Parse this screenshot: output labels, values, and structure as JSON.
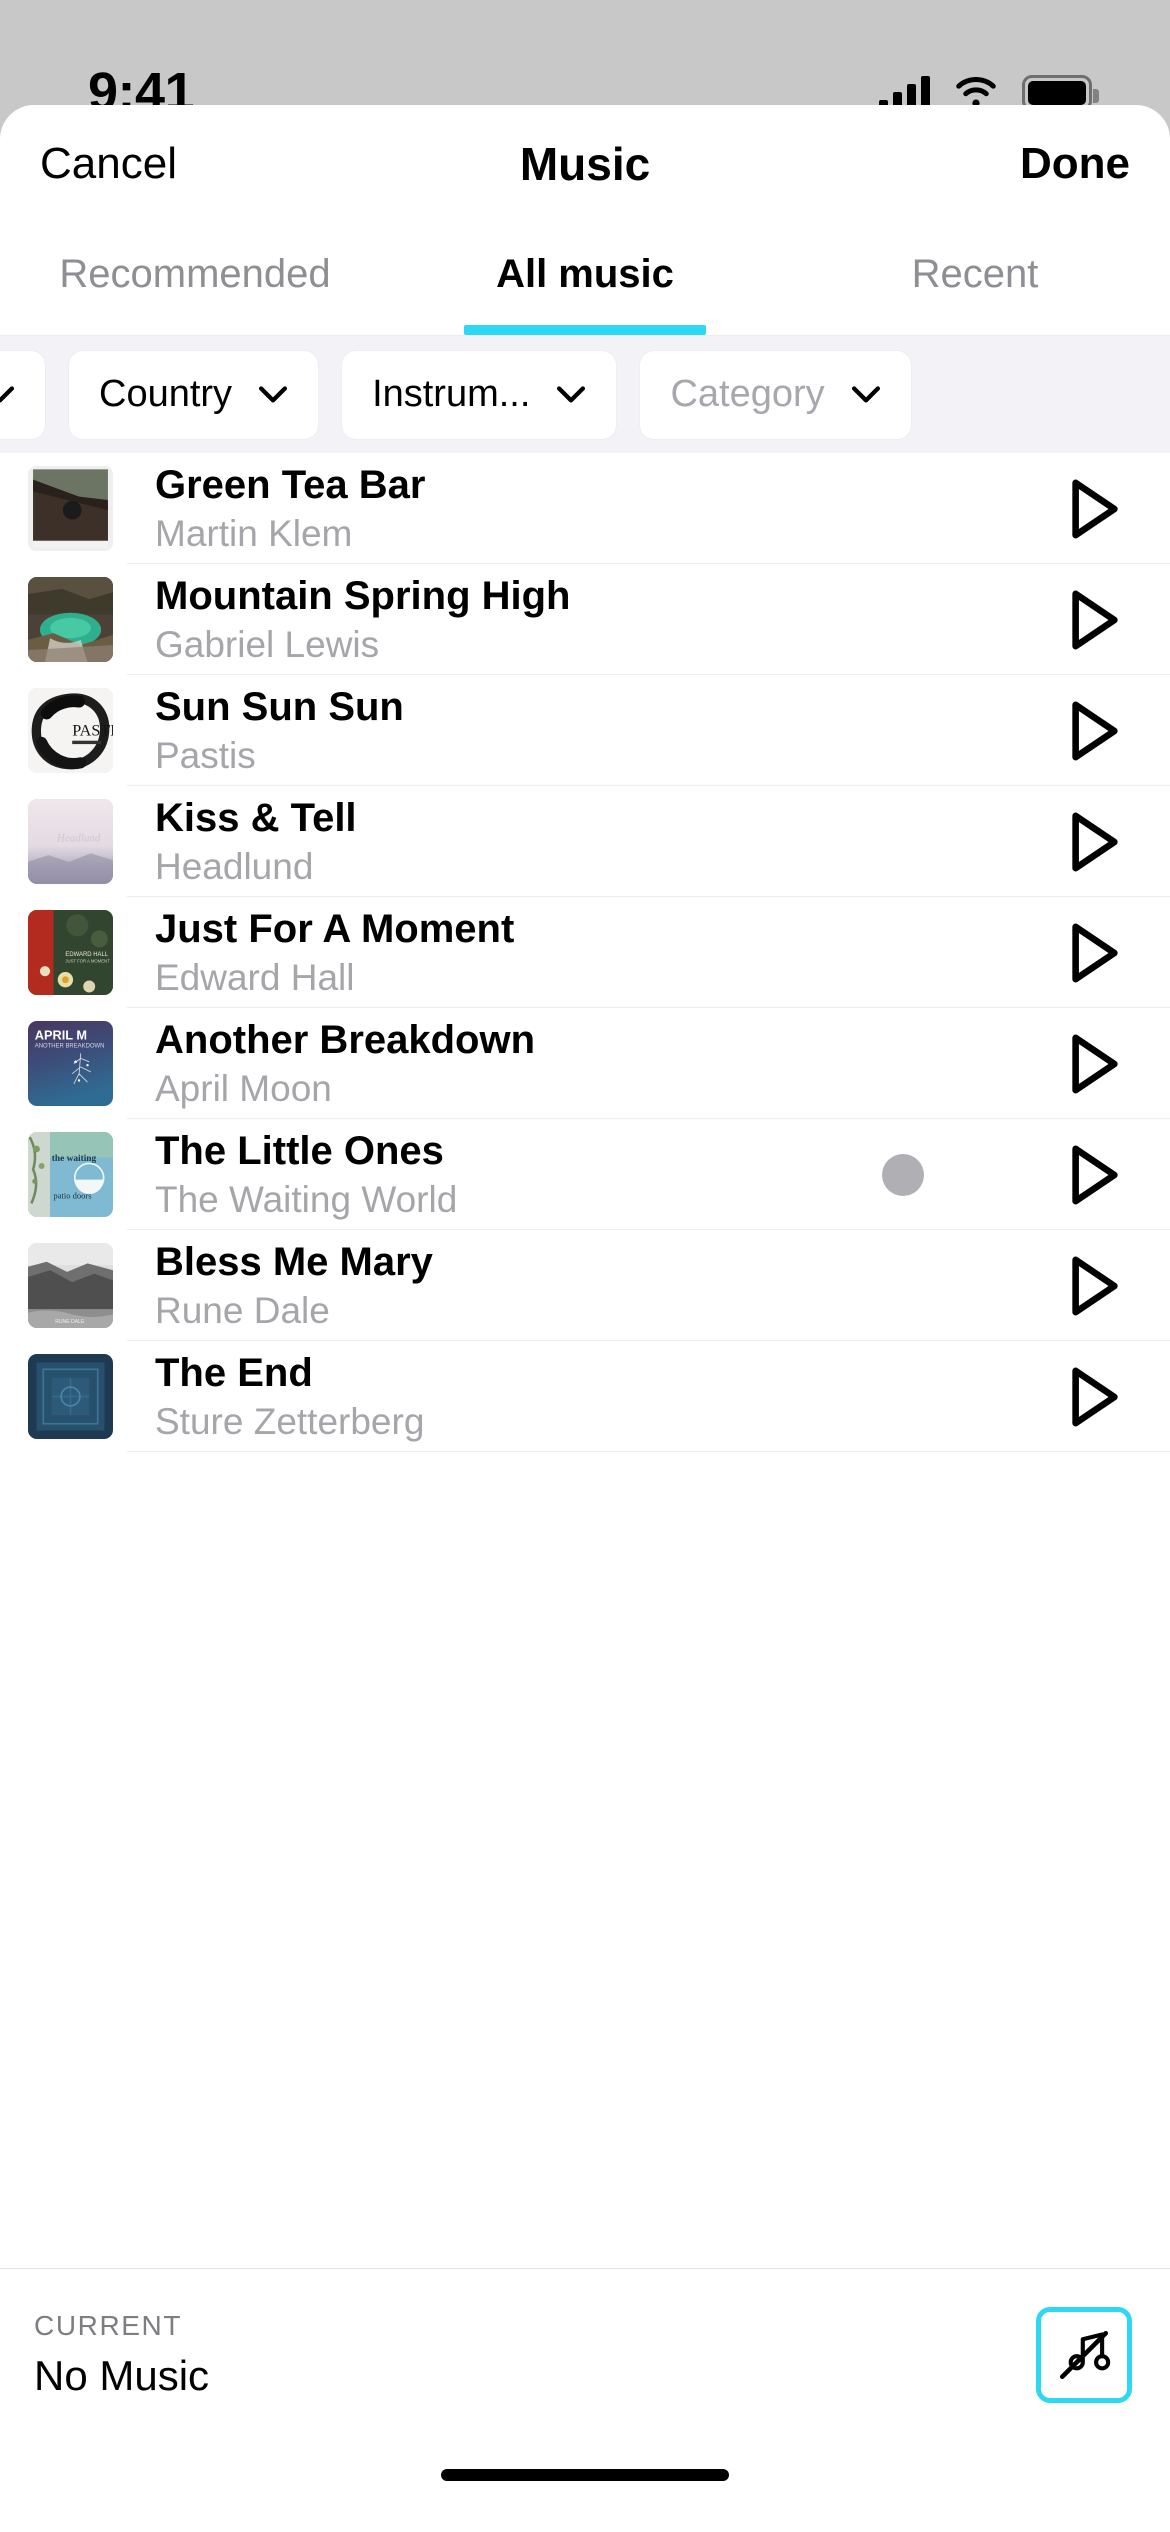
{
  "status_bar": {
    "time": "9:41",
    "icons": [
      "cellular-signal-icon",
      "wifi-icon",
      "battery-icon"
    ]
  },
  "header": {
    "cancel_label": "Cancel",
    "title": "Music",
    "done_label": "Done"
  },
  "tabs": {
    "items": [
      {
        "label": "Recommended",
        "active": false
      },
      {
        "label": "All music",
        "active": true
      },
      {
        "label": "Recent",
        "active": false
      }
    ],
    "active_indicator_color": "#2ed8f2"
  },
  "filters": {
    "chips": [
      {
        "label": "",
        "placeholder": false,
        "partial": true
      },
      {
        "label": "Country",
        "placeholder": false,
        "partial": false
      },
      {
        "label": "Instrum...",
        "placeholder": false,
        "partial": false
      },
      {
        "label": "Category",
        "placeholder": true,
        "partial": false
      }
    ]
  },
  "songs": [
    {
      "title": "Green Tea Bar",
      "artist": "Martin Klem",
      "art": "forest-bridge",
      "selected": false
    },
    {
      "title": "Mountain Spring High",
      "artist": "Gabriel Lewis",
      "art": "waterfall",
      "selected": false
    },
    {
      "title": "Sun Sun Sun",
      "artist": "Pastis",
      "art": "pastis-ink",
      "selected": false
    },
    {
      "title": "Kiss & Tell",
      "artist": "Headlund",
      "art": "pink-haze",
      "selected": false
    },
    {
      "title": "Just For A Moment",
      "artist": "Edward Hall",
      "art": "red-flowers",
      "selected": false
    },
    {
      "title": "Another Breakdown",
      "artist": "April Moon",
      "art": "april-moon",
      "selected": false
    },
    {
      "title": "The Little Ones",
      "artist": "The Waiting World",
      "art": "waiting-world",
      "selected": true
    },
    {
      "title": "Bless Me Mary",
      "artist": "Rune Dale",
      "art": "gray-cliffs",
      "selected": false
    },
    {
      "title": "The End",
      "artist": "Sture Zetterberg",
      "art": "blue-square",
      "selected": false
    }
  ],
  "bottom_bar": {
    "current_label": "CURRENT",
    "current_value": "No Music",
    "mute_icon": "music-note-off-icon",
    "accent_color": "#2ed8f2"
  }
}
